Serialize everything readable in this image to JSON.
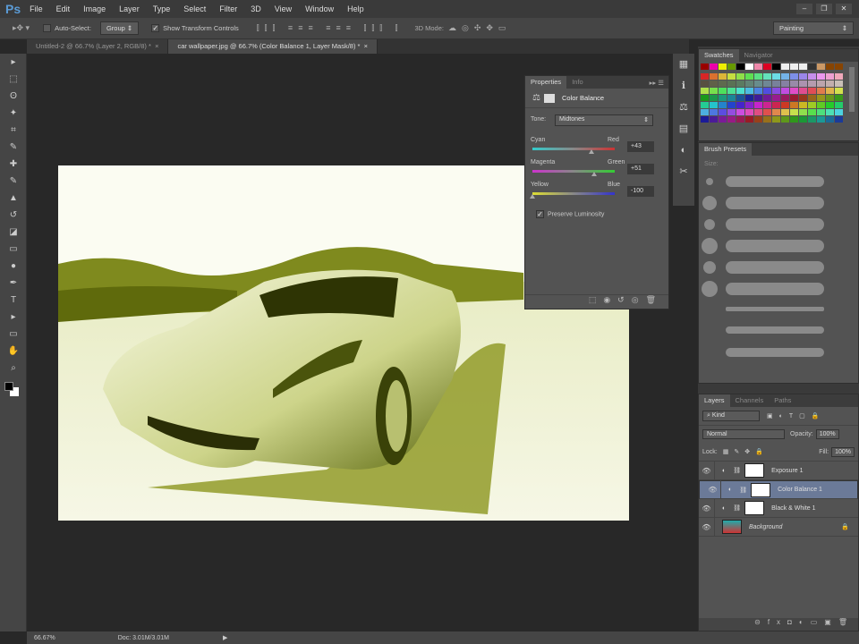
{
  "app": {
    "logo": "Ps",
    "menu": [
      "File",
      "Edit",
      "Image",
      "Layer",
      "Type",
      "Select",
      "Filter",
      "3D",
      "View",
      "Window",
      "Help"
    ],
    "window_controls": [
      "–",
      "❐",
      "✕"
    ]
  },
  "options": {
    "auto_select_label": "Auto-Select:",
    "auto_select_checked": false,
    "auto_select_value": "Group",
    "show_transform_label": "Show Transform Controls",
    "show_transform_checked": true,
    "mode_3d_label": "3D Mode:",
    "workspace": "Painting"
  },
  "tabs": [
    {
      "label": "Untitled-2 @ 66.7% (Layer 2, RGB/8) *",
      "active": false
    },
    {
      "label": "car wallpaper.jpg @ 66.7% (Color Balance 1, Layer Mask/8) *",
      "active": true
    }
  ],
  "properties": {
    "tabs": [
      "Properties",
      "Info"
    ],
    "title": "Color Balance",
    "tone_label": "Tone:",
    "tone_value": "Midtones",
    "sliders": [
      {
        "left": "Cyan",
        "right": "Red",
        "value": "+43",
        "num": 43,
        "gradient": [
          "#3cc",
          "#c33"
        ]
      },
      {
        "left": "Magenta",
        "right": "Green",
        "value": "+51",
        "num": 51,
        "gradient": [
          "#c3c",
          "#3c3"
        ]
      },
      {
        "left": "Yellow",
        "right": "Blue",
        "value": "-100",
        "num": -100,
        "gradient": [
          "#dd3",
          "#33c"
        ]
      }
    ],
    "preserve_luminosity": "Preserve Luminosity",
    "preserve_checked": true
  },
  "swatches": {
    "tabs": [
      "Swatches",
      "Navigator"
    ]
  },
  "brush": {
    "title": "Brush Presets",
    "size_label": "Size:"
  },
  "layers": {
    "tabs": [
      "Layers",
      "Channels",
      "Paths"
    ],
    "filter": "Kind",
    "blend": "Normal",
    "opacity_label": "Opacity:",
    "opacity": "100%",
    "lock_label": "Lock:",
    "fill_label": "Fill:",
    "fill": "100%",
    "items": [
      {
        "name": "Exposure 1",
        "selected": false
      },
      {
        "name": "Color Balance 1",
        "selected": true
      },
      {
        "name": "Black & White 1",
        "selected": false
      },
      {
        "name": "Background",
        "selected": false
      }
    ]
  },
  "status": {
    "zoom": "66.67%",
    "doc": "Doc: 3.01M/3.01M"
  }
}
